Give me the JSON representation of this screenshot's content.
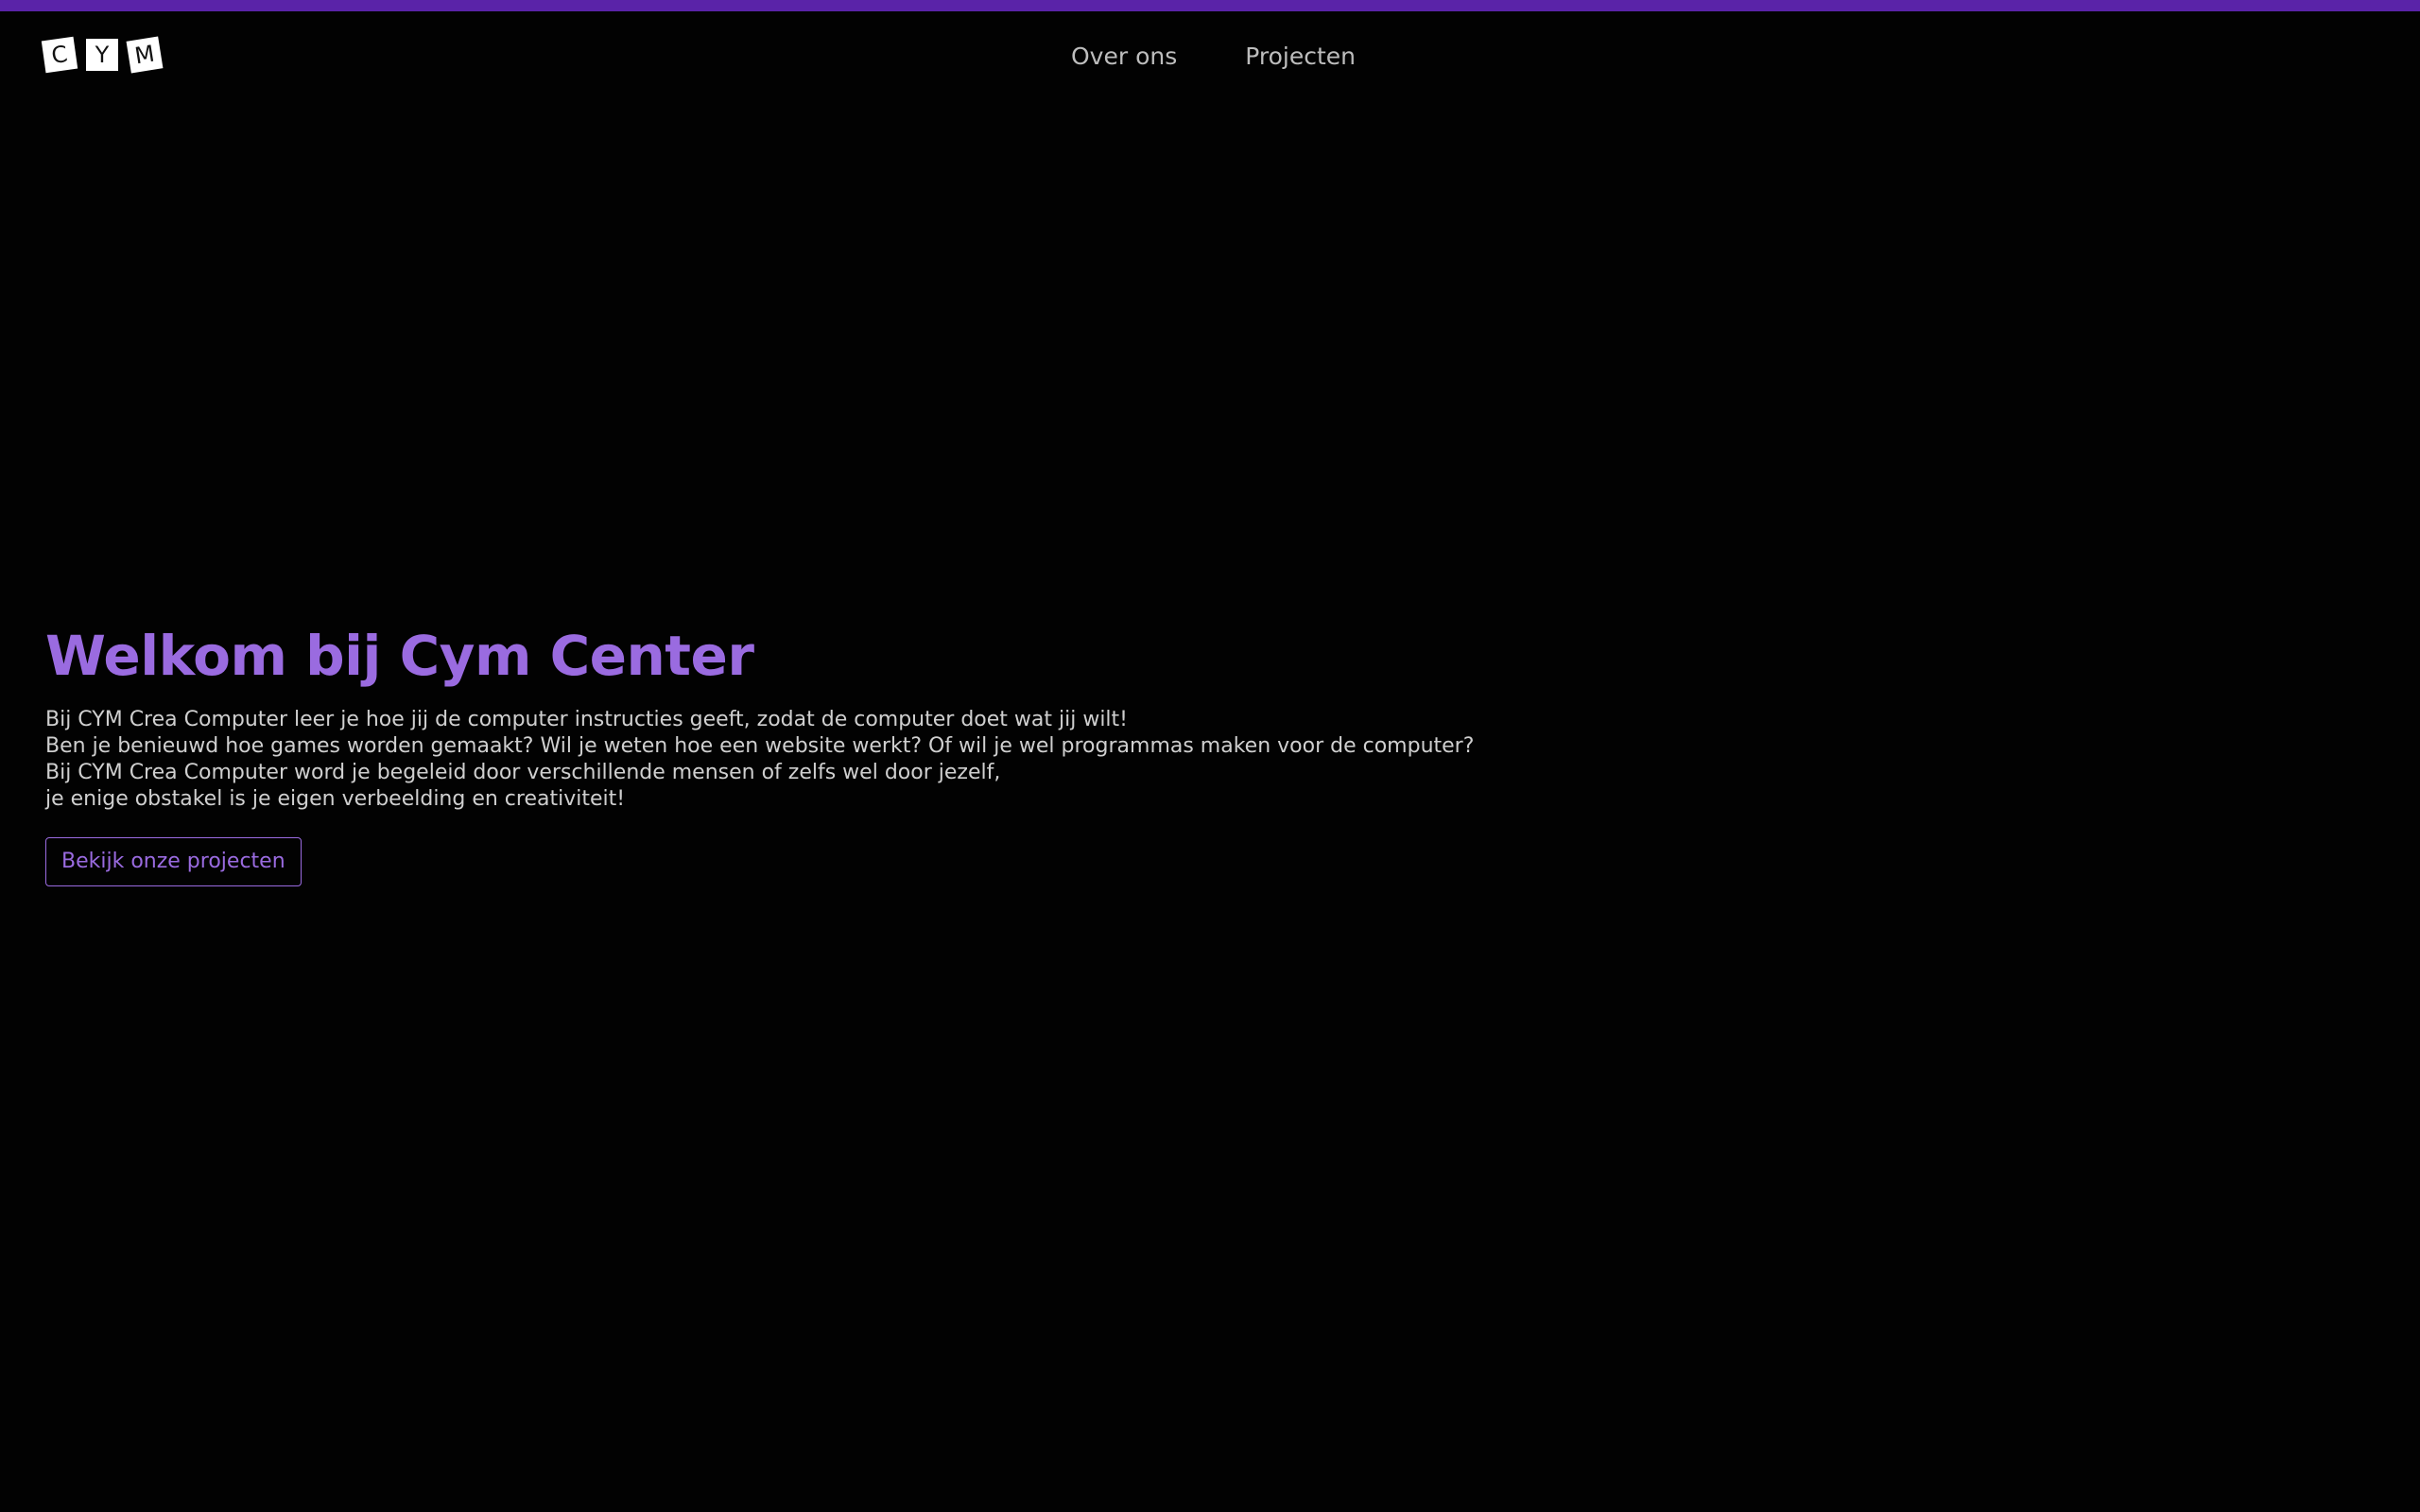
{
  "colors": {
    "accent": "#5a23a8",
    "title": "#9a6be0",
    "button": "#9a6be0"
  },
  "logo": {
    "letters": [
      "C",
      "Y",
      "M"
    ]
  },
  "nav": {
    "items": [
      {
        "label": "Over ons"
      },
      {
        "label": "Projecten"
      }
    ]
  },
  "hero": {
    "title": "Welkom bij Cym Center",
    "lines": [
      "Bij CYM Crea Computer leer je hoe jij de computer instructies geeft, zodat de computer doet wat jij wilt!",
      "Ben je benieuwd hoe games worden gemaakt? Wil je weten hoe een website werkt? Of wil je wel programmas maken voor de computer?",
      "Bij CYM Crea Computer word je begeleid door verschillende mensen of zelfs wel door jezelf,",
      "je enige obstakel is je eigen verbeelding en creativiteit!"
    ],
    "button_label": "Bekijk onze projecten"
  }
}
